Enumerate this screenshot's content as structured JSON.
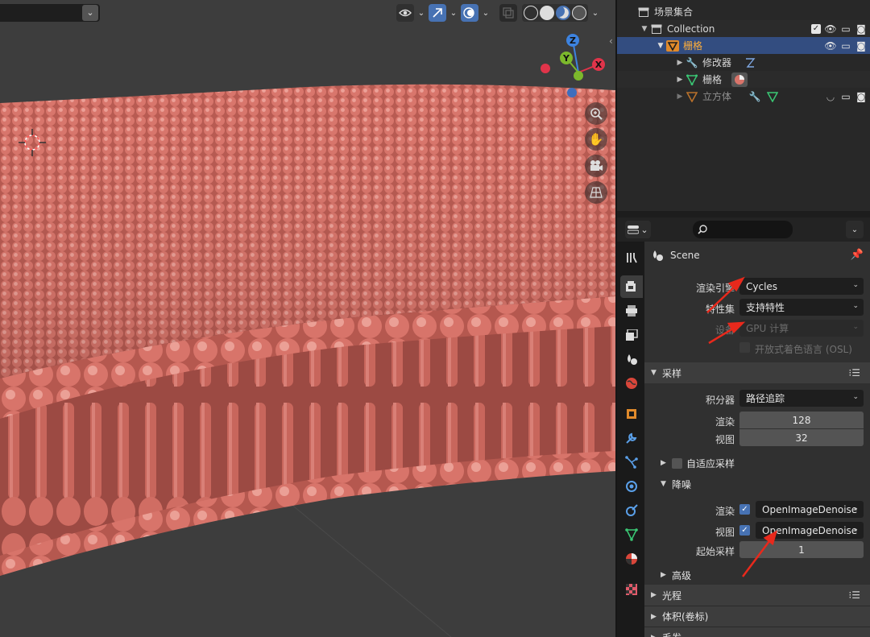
{
  "viewport": {
    "gizmo": {
      "z": "Z",
      "y": "Y",
      "x": "X"
    },
    "toolbar": {
      "visibility": "eye-icon",
      "gizmo": "gizmo-icon",
      "overlay": "overlay-icon",
      "xray": "xray-icon"
    }
  },
  "outliner": {
    "scene_collection": "场景集合",
    "collection": "Collection",
    "grid_object": "栅格",
    "modifiers": "修改器",
    "mesh_data": "栅格",
    "cube": "立方体"
  },
  "properties": {
    "context": "Scene",
    "render_engine": {
      "label": "渲染引擎",
      "value": "Cycles"
    },
    "feature_set": {
      "label": "特性集",
      "value": "支持特性"
    },
    "device": {
      "label": "设备",
      "value": "GPU 计算"
    },
    "osl": "开放式着色语言 (OSL)",
    "sampling": {
      "title": "采样",
      "integrator": {
        "label": "积分器",
        "value": "路径追踪"
      },
      "render": {
        "label": "渲染",
        "value": "128"
      },
      "viewport": {
        "label": "视图",
        "value": "32"
      },
      "adaptive": "自适应采样",
      "denoise": {
        "title": "降噪",
        "render": {
          "label": "渲染",
          "value": "OpenImageDenoise"
        },
        "viewport": {
          "label": "视图",
          "value": "OpenImageDenoise"
        },
        "start_sample": {
          "label": "起始采样",
          "value": "1"
        }
      },
      "advanced": "高级"
    },
    "light_paths": "光程",
    "volumes": "体积(卷标)",
    "hair": "毛发"
  },
  "colors": {
    "lipid": "#d9746a",
    "accent": "#4772b3",
    "selected_text": "#ffae3a",
    "annotation": "#e8291c"
  }
}
